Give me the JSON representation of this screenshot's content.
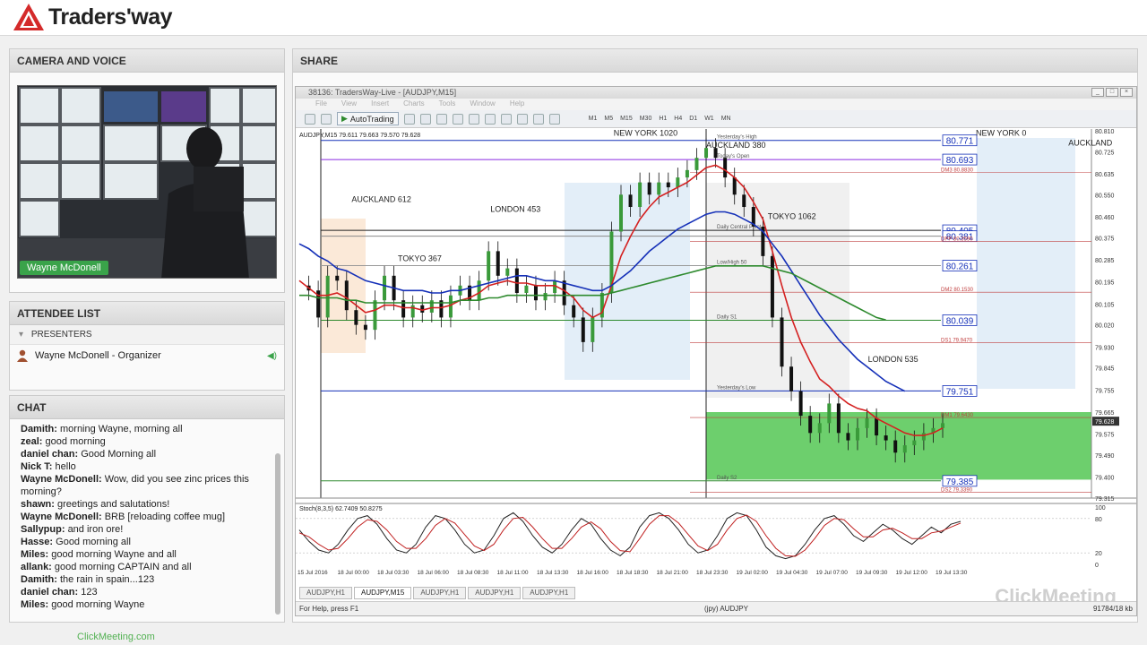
{
  "brand": {
    "name": "Traders'way"
  },
  "camera": {
    "title": "CAMERA AND VOICE",
    "presenter_name": "Wayne McDonell"
  },
  "attendees": {
    "title": "ATTENDEE LIST",
    "presenters_label": "PRESENTERS",
    "presenter": "Wayne McDonell - Organizer"
  },
  "chat": {
    "title": "CHAT",
    "messages": [
      {
        "author": "Damith:",
        "text": "morning Wayne, morning all"
      },
      {
        "author": "zeal:",
        "text": "good morning"
      },
      {
        "author": "daniel chan:",
        "text": "Good Morning all"
      },
      {
        "author": "Nick T:",
        "text": "hello"
      },
      {
        "author": "Wayne McDonell:",
        "text": "Wow, did you see zinc prices this morning?"
      },
      {
        "author": "shawn:",
        "text": "greetings and salutations!"
      },
      {
        "author": "Wayne McDonell:",
        "text": "BRB [reloading coffee mug]"
      },
      {
        "author": "Sallypup:",
        "text": "and iron ore!"
      },
      {
        "author": "Hasse:",
        "text": "Good morning all"
      },
      {
        "author": "Miles:",
        "text": "good morning Wayne and all"
      },
      {
        "author": "allank:",
        "text": "good morning CAPTAIN and all"
      },
      {
        "author": "Damith:",
        "text": "the rain in spain...123"
      },
      {
        "author": "daniel chan:",
        "text": "123"
      },
      {
        "author": "Miles:",
        "text": "good morning Wayne"
      }
    ]
  },
  "share": {
    "title": "SHARE"
  },
  "footer": {
    "link": "ClickMeeting.com"
  },
  "mt4": {
    "window_title": "38136: TradersWay-Live - [AUDJPY,M15]",
    "menu": [
      "File",
      "View",
      "Insert",
      "Charts",
      "Tools",
      "Window",
      "Help"
    ],
    "autotrading_label": "AutoTrading",
    "timeframes": [
      "M1",
      "M5",
      "M15",
      "M30",
      "H1",
      "H4",
      "D1",
      "W1",
      "MN"
    ],
    "tabs": [
      "AUDJPY,H1",
      "AUDJPY,M15",
      "AUDJPY,H1",
      "AUDJPY,H1",
      "AUDJPY,H1"
    ],
    "active_tab_index": 1,
    "status_help": "For Help, press F1",
    "status_symbol": "(jpy) AUDJPY",
    "status_traffic": "91784/18 kb",
    "watermark": "ClickMeeting"
  },
  "chart_data": {
    "type": "line",
    "symbol_header": "AUDJPY,M15  79.611 79.663 79.570 79.628",
    "indicator_header": "Stoch(8,3,5) 62.7409 50.8275",
    "ylim": [
      79.315,
      80.81
    ],
    "y_ticks": [
      80.81,
      80.725,
      80.635,
      80.55,
      80.46,
      80.375,
      80.285,
      80.195,
      80.105,
      80.02,
      79.93,
      79.845,
      79.755,
      79.665,
      79.575,
      79.49,
      79.4,
      79.315
    ],
    "current_price": "79.628",
    "x_ticks": [
      "15 Jul 2016",
      "18 Jul 00:00",
      "18 Jul 03:30",
      "18 Jul 06:00",
      "18 Jul 08:30",
      "18 Jul 11:00",
      "18 Jul 13:30",
      "18 Jul 16:00",
      "18 Jul 18:30",
      "18 Jul 21:00",
      "18 Jul 23:30",
      "19 Jul 02:00",
      "19 Jul 04:30",
      "19 Jul 07:00",
      "19 Jul 09:30",
      "19 Jul 12:00",
      "19 Jul 13:30"
    ],
    "session_labels": [
      {
        "text": "AUCKLAND 612",
        "x": 0.04,
        "price": 80.52
      },
      {
        "text": "TOKYO 367",
        "x": 0.1,
        "price": 80.28
      },
      {
        "text": "LONDON 453",
        "x": 0.22,
        "price": 80.48
      },
      {
        "text": "NEW YORK 1020",
        "x": 0.38,
        "price": 80.79
      },
      {
        "text": "AUCKLAND 380",
        "x": 0.5,
        "price": 80.74
      },
      {
        "text": "TOKYO 1062",
        "x": 0.58,
        "price": 80.45
      },
      {
        "text": "LONDON 535",
        "x": 0.71,
        "price": 79.87
      },
      {
        "text": "NEW YORK 0",
        "x": 0.85,
        "price": 80.79
      },
      {
        "text": "AUCKLAND",
        "x": 0.97,
        "price": 80.75
      }
    ],
    "level_boxes": [
      {
        "label": "80.771",
        "price": 80.771,
        "note": "Yesterday's High"
      },
      {
        "label": "80.693",
        "price": 80.693,
        "note": "Today's Open"
      },
      {
        "label": "80.405",
        "price": 80.405,
        "note": "Daily Central Pivot"
      },
      {
        "label": "80.381",
        "price": 80.381,
        "note": ""
      },
      {
        "label": "80.261",
        "price": 80.261,
        "note": "Low/High 50"
      },
      {
        "label": "80.039",
        "price": 80.039,
        "note": "Daily S1"
      },
      {
        "label": "79.751",
        "price": 79.751,
        "note": "Yesterday's Low"
      },
      {
        "label": "79.385",
        "price": 79.385,
        "note": "Daily S2"
      }
    ],
    "pivot_notes": [
      {
        "text": "DM3 80.8830",
        "price": 80.64
      },
      {
        "text": "DPP 80.3590",
        "price": 80.359
      },
      {
        "text": "DM2 80.1530",
        "price": 80.153
      },
      {
        "text": "DS1 79.9470",
        "price": 79.947
      },
      {
        "text": "DM1 79.6430",
        "price": 79.643
      },
      {
        "text": "DS2 79.3390",
        "price": 79.339
      }
    ],
    "series": [
      {
        "name": "price",
        "color": "#111111",
        "values": [
          80.18,
          80.16,
          80.05,
          80.22,
          80.2,
          80.08,
          80.02,
          80.0,
          80.12,
          80.22,
          80.12,
          80.05,
          80.1,
          80.07,
          80.12,
          80.05,
          80.14,
          80.18,
          80.12,
          80.2,
          80.32,
          80.22,
          80.25,
          80.15,
          80.18,
          80.12,
          80.15,
          80.2,
          80.1,
          80.05,
          79.95,
          80.05,
          80.15,
          80.4,
          80.55,
          80.5,
          80.6,
          80.55,
          80.6,
          80.58,
          80.62,
          80.65,
          80.7,
          80.74,
          80.7,
          80.62,
          80.55,
          80.5,
          80.42,
          80.3,
          80.05,
          79.85,
          79.75,
          79.65,
          79.58,
          79.62,
          79.7,
          79.58,
          79.55,
          79.6,
          79.64,
          79.57,
          79.55,
          79.5,
          79.53,
          79.55,
          79.58,
          79.6,
          79.62
        ]
      },
      {
        "name": "red MA",
        "color": "#d42020",
        "values": [
          80.2,
          80.17,
          80.14,
          80.14,
          80.15,
          80.13,
          80.1,
          80.07,
          80.08,
          80.1,
          80.1,
          80.09,
          80.09,
          80.08,
          80.09,
          80.09,
          80.1,
          80.12,
          80.13,
          80.15,
          80.18,
          80.19,
          80.2,
          80.19,
          80.19,
          80.18,
          80.18,
          80.18,
          80.16,
          80.13,
          80.08,
          80.05,
          80.07,
          80.18,
          80.3,
          80.38,
          80.45,
          80.5,
          80.54,
          80.56,
          80.58,
          80.6,
          80.63,
          80.66,
          80.67,
          80.65,
          80.62,
          80.58,
          80.52,
          80.45,
          80.32,
          80.18,
          80.05,
          79.95,
          79.87,
          79.8,
          79.77,
          79.73,
          79.7,
          79.68,
          79.67,
          79.64,
          79.62,
          79.6,
          79.58,
          79.57,
          79.57,
          79.58,
          79.6
        ]
      },
      {
        "name": "blue MA",
        "color": "#1530b8",
        "values": [
          80.35,
          80.33,
          80.3,
          80.28,
          80.25,
          80.24,
          80.22,
          80.2,
          80.19,
          80.18,
          80.17,
          80.16,
          80.16,
          80.16,
          80.15,
          80.15,
          80.16,
          80.16,
          80.17,
          80.18,
          80.19,
          80.2,
          80.21,
          80.22,
          80.22,
          80.21,
          80.2,
          80.2,
          80.19,
          80.18,
          80.17,
          80.16,
          80.16,
          80.18,
          80.21,
          80.24,
          80.28,
          80.32,
          80.35,
          80.38,
          80.41,
          80.43,
          80.45,
          80.47,
          80.48,
          80.48,
          80.47,
          80.45,
          80.43,
          80.4,
          80.35,
          80.3,
          80.24,
          80.18,
          80.12,
          80.06,
          80.01,
          79.96,
          79.92,
          79.88,
          79.85,
          79.82,
          79.79,
          79.77,
          79.75,
          null,
          null,
          null,
          null
        ]
      },
      {
        "name": "green MA",
        "color": "#2e8a2e",
        "values": [
          80.14,
          80.14,
          80.13,
          80.13,
          80.13,
          80.12,
          80.12,
          80.11,
          80.11,
          80.11,
          80.11,
          80.11,
          80.11,
          80.11,
          80.11,
          80.11,
          80.11,
          80.12,
          80.12,
          80.12,
          80.13,
          80.13,
          80.14,
          80.14,
          80.14,
          80.14,
          80.14,
          80.14,
          80.14,
          80.14,
          80.14,
          80.14,
          80.14,
          80.15,
          80.16,
          80.17,
          80.18,
          80.19,
          80.2,
          80.21,
          80.22,
          80.23,
          80.24,
          80.25,
          80.26,
          80.26,
          80.26,
          80.26,
          80.26,
          80.26,
          80.25,
          80.24,
          80.23,
          80.21,
          80.19,
          80.17,
          80.15,
          80.13,
          80.11,
          80.09,
          80.07,
          80.05,
          80.04,
          null,
          null,
          null,
          null,
          null,
          null
        ]
      }
    ],
    "stochastic": {
      "ylim": [
        0,
        100
      ],
      "y_ticks": [
        100,
        80,
        20,
        0
      ],
      "main": [
        60,
        40,
        25,
        20,
        35,
        60,
        80,
        85,
        70,
        45,
        25,
        20,
        35,
        65,
        85,
        80,
        60,
        35,
        20,
        25,
        50,
        80,
        90,
        75,
        50,
        30,
        20,
        35,
        60,
        80,
        70,
        45,
        25,
        15,
        30,
        65,
        85,
        90,
        80,
        60,
        35,
        20,
        25,
        50,
        80,
        90,
        85,
        60,
        30,
        15,
        10,
        15,
        35,
        60,
        80,
        85,
        70,
        50,
        40,
        55,
        70,
        60,
        45,
        35,
        50,
        65,
        55,
        70,
        75
      ],
      "signal": [
        55,
        48,
        35,
        25,
        28,
        45,
        65,
        78,
        75,
        60,
        40,
        28,
        28,
        45,
        68,
        80,
        72,
        52,
        32,
        24,
        35,
        60,
        80,
        82,
        65,
        45,
        28,
        28,
        45,
        65,
        74,
        62,
        40,
        24,
        22,
        45,
        70,
        85,
        85,
        72,
        52,
        32,
        24,
        35,
        60,
        80,
        86,
        75,
        50,
        28,
        15,
        14,
        25,
        45,
        68,
        80,
        78,
        62,
        48,
        48,
        60,
        63,
        55,
        45,
        45,
        55,
        58,
        65,
        72
      ]
    }
  }
}
